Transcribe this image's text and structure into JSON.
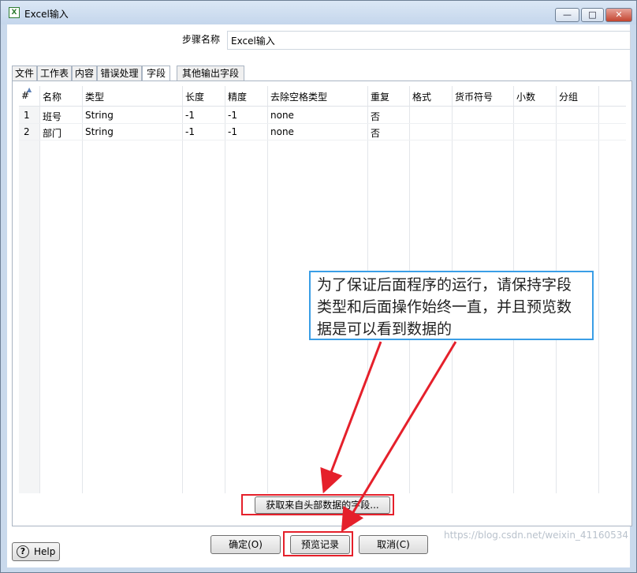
{
  "window": {
    "title": "Excel输入",
    "icon": "excel-file-icon",
    "controls": {
      "minimize": "—",
      "maximize": "□",
      "close": "✕"
    }
  },
  "step_name": {
    "label": "步骤名称",
    "value": "Excel输入"
  },
  "tabs": [
    {
      "label": "文件",
      "active": false
    },
    {
      "label": "工作表",
      "active": false
    },
    {
      "label": "内容",
      "active": false
    },
    {
      "label": "错误处理",
      "active": false
    },
    {
      "label": "字段",
      "active": true
    },
    {
      "label": "其他输出字段",
      "active": false
    }
  ],
  "fields_table": {
    "columns": [
      "#",
      "名称",
      "类型",
      "长度",
      "精度",
      "去除空格类型",
      "重复",
      "格式",
      "货币符号",
      "小数",
      "分组"
    ],
    "rows": [
      [
        "1",
        "班号",
        "String",
        "-1",
        "-1",
        "none",
        "否",
        "",
        "",
        "",
        ""
      ],
      [
        "2",
        "部门",
        "String",
        "-1",
        "-1",
        "none",
        "否",
        "",
        "",
        "",
        ""
      ]
    ]
  },
  "buttons": {
    "get_fields": "获取来自头部数据的字段...",
    "ok": "确定(O)",
    "preview": "预览记录",
    "cancel": "取消(C)",
    "help": "Help"
  },
  "annotation": {
    "callout_text": "为了保证后面程序的运行，请保持字段类型和后面操作始终一直，并且预览数据是可以看到数据的",
    "highlight_color": "#e5202b",
    "callout_border_color": "#3a9ee6"
  },
  "watermark": "https://blog.csdn.net/weixin_41160534"
}
